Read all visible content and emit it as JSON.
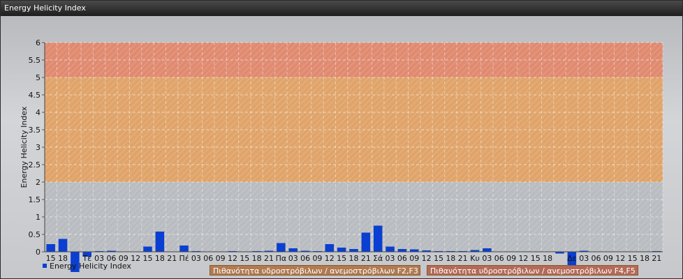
{
  "window": {
    "title": "Energy Helicity Index"
  },
  "legend": {
    "series_label": "Energy Helicity Index",
    "band_f2f3": "Πιθανότητα υδροστρόβιλων / ανεμοστρόβιλων F2,F3",
    "band_f4f5": "Πιθανότητα υδροστρόβιλων / ανεμοστρόβιλων F4,F5"
  },
  "chart_data": {
    "type": "bar",
    "ylabel": "Energy Helicity Index",
    "ylim": [
      0,
      6
    ],
    "yticks": [
      "0",
      "0.5",
      "1",
      "1.5",
      "2",
      "2.5",
      "3",
      "3.5",
      "4",
      "4.5",
      "5",
      "5.5",
      "6"
    ],
    "bands": [
      {
        "from": 2,
        "to": 5,
        "color": "#e0a46a"
      },
      {
        "from": 5,
        "to": 6,
        "color": "#e08a70"
      }
    ],
    "bar_color": "#0a3fd1",
    "categories": [
      "15",
      "18",
      "",
      "Τε",
      "03",
      "06",
      "09",
      "12",
      "15",
      "18",
      "21",
      "Πέ",
      "03",
      "06",
      "09",
      "12",
      "15",
      "18",
      "21",
      "Πα",
      "03",
      "06",
      "09",
      "12",
      "15",
      "18",
      "21",
      "Σά",
      "03",
      "06",
      "09",
      "12",
      "15",
      "18",
      "21",
      "Κυ",
      "03",
      "06",
      "09",
      "12",
      "15",
      "18",
      "",
      "Δε",
      "03",
      "06",
      "09",
      "12",
      "15",
      "18",
      "21"
    ],
    "values": [
      0.22,
      0.37,
      -0.58,
      -0.14,
      0.02,
      0.03,
      0.01,
      0.01,
      0.15,
      0.58,
      0.01,
      0.18,
      0.02,
      0.01,
      0.01,
      0.02,
      0.01,
      0.02,
      0.03,
      0.25,
      0.1,
      0.03,
      0.02,
      0.22,
      0.12,
      0.08,
      0.55,
      0.75,
      0.15,
      0.08,
      0.07,
      0.04,
      0.02,
      0.02,
      0.02,
      0.05,
      0.1,
      0.01,
      0.01,
      0.01,
      0.01,
      0.01,
      -0.05,
      -0.38,
      0.03,
      0.01,
      0.01,
      0.01,
      0.01,
      0.01,
      0.02
    ]
  }
}
